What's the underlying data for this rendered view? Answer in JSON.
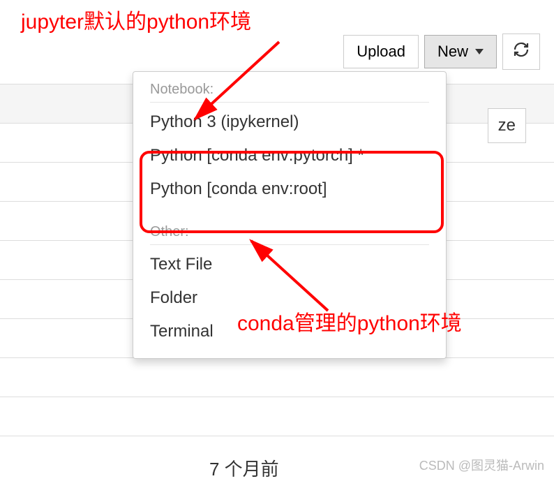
{
  "annotations": {
    "default_kernel": "jupyter默认的python环境",
    "conda_kernel": "conda管理的python环境"
  },
  "toolbar": {
    "upload_label": "Upload",
    "new_label": "New",
    "refresh_label": "Refresh"
  },
  "dropdown": {
    "section_notebook": "Notebook:",
    "section_other": "Other:",
    "notebook_items": [
      "Python 3 (ipykernel)",
      "Python [conda env:pytorch] *",
      "Python [conda env:root]"
    ],
    "other_items": [
      "Text File",
      "Folder",
      "Terminal"
    ]
  },
  "fragments": {
    "right_text": "ze",
    "timestamp": "7 个月前"
  },
  "watermark": "CSDN @图灵猫-Arwin"
}
